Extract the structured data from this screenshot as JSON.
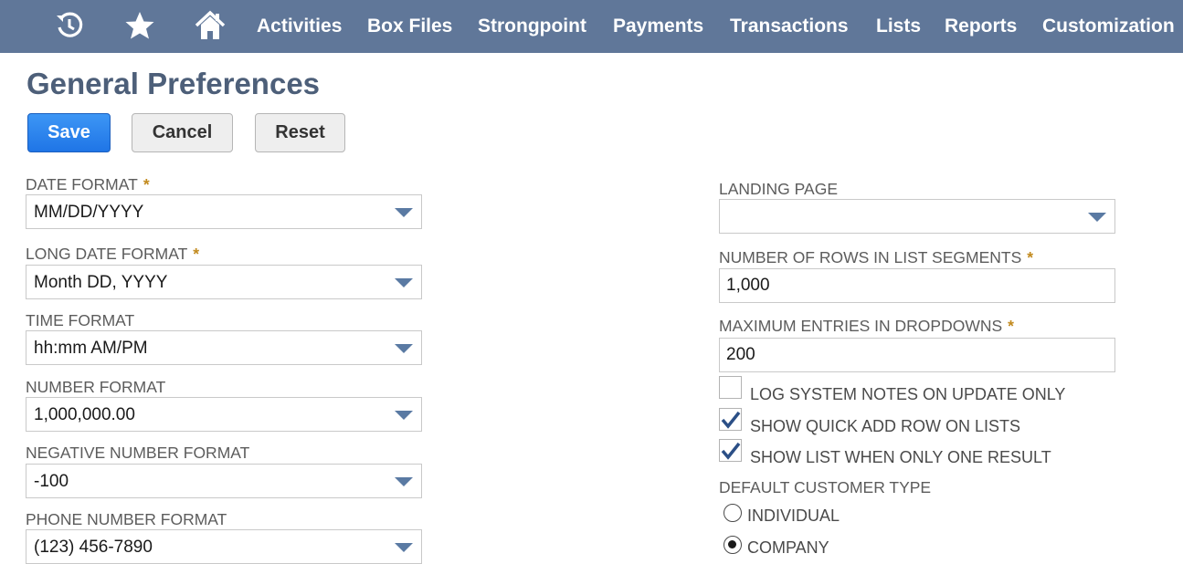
{
  "nav": {
    "icons": {
      "recent": "recent-history-icon",
      "favorites": "star-icon",
      "home": "home-icon"
    },
    "items": [
      "Activities",
      "Box Files",
      "Strongpoint",
      "Payments",
      "Transactions",
      "Lists",
      "Reports",
      "Customization"
    ]
  },
  "page": {
    "title": "General Preferences"
  },
  "actions": {
    "save": "Save",
    "cancel": "Cancel",
    "reset": "Reset"
  },
  "required_marker": "*",
  "left_fields": {
    "date_format": {
      "label": "Date Format",
      "value": "MM/DD/YYYY",
      "required": true
    },
    "long_date_format": {
      "label": "Long Date Format",
      "value": "Month DD, YYYY",
      "required": true
    },
    "time_format": {
      "label": "Time Format",
      "value": "hh:mm AM/PM"
    },
    "number_format": {
      "label": "Number Format",
      "value": "1,000,000.00"
    },
    "negative_number_format": {
      "label": "Negative Number Format",
      "value": "-100"
    },
    "phone_number_format": {
      "label": "Phone Number Format",
      "value": "(123) 456-7890"
    }
  },
  "right_fields": {
    "landing_page": {
      "label": "Landing Page",
      "value": ""
    },
    "rows_in_list_segments": {
      "label": "Number of Rows in List Segments",
      "value": "1,000",
      "required": true
    },
    "max_dropdown_entries": {
      "label": "Maximum Entries in Dropdowns",
      "value": "200",
      "required": true
    }
  },
  "checkboxes": {
    "log_system_notes": {
      "label": "Log System Notes on Update Only",
      "checked": false
    },
    "show_quick_add": {
      "label": "Show Quick Add Row on Lists",
      "checked": true
    },
    "show_list_one_result": {
      "label": "Show List When Only One Result",
      "checked": true
    }
  },
  "customer_type": {
    "label": "Default Customer Type",
    "options": [
      "Individual",
      "Company"
    ],
    "selected": "Company"
  },
  "colors": {
    "nav_bg": "#607799",
    "title": "#4d5f79",
    "primary": "#1f75e6",
    "required": "#c28a1e",
    "check": "#2b4f86"
  }
}
